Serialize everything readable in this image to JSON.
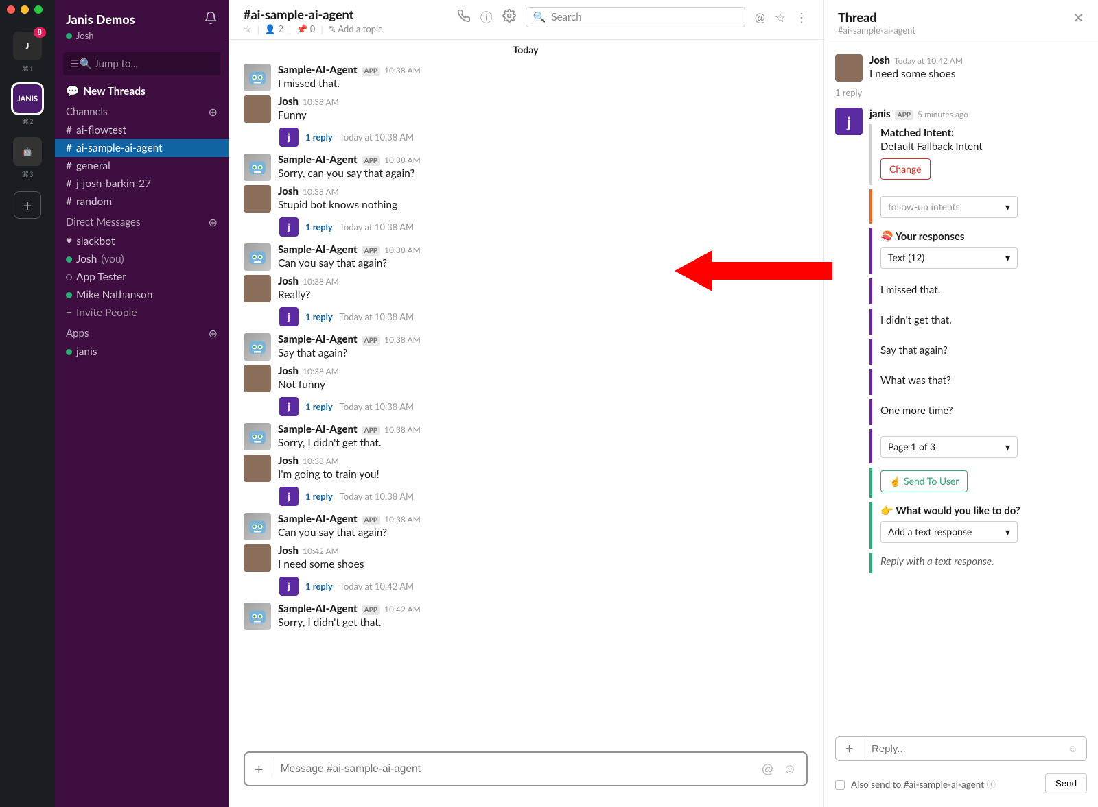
{
  "workspace": {
    "badge": "8",
    "keys": [
      "⌘1",
      "⌘2",
      "⌘3"
    ],
    "title": "Janis Demos",
    "user": "Josh",
    "jump_placeholder": "Jump to...",
    "new_threads": "New Threads",
    "channels_label": "Channels",
    "channels": [
      "ai-flowtest",
      "ai-sample-ai-agent",
      "general",
      "j-josh-barkin-27",
      "random"
    ],
    "active_channel_index": 1,
    "dm_label": "Direct Messages",
    "dms": [
      {
        "name": "slackbot",
        "presence": "heart"
      },
      {
        "name": "Josh",
        "suffix": "(you)",
        "presence": "active"
      },
      {
        "name": "App Tester",
        "presence": "away"
      },
      {
        "name": "Mike Nathanson",
        "presence": "active"
      }
    ],
    "invite": "Invite People",
    "apps_label": "Apps",
    "apps": [
      {
        "name": "janis",
        "presence": "active"
      }
    ]
  },
  "header": {
    "channel": "#ai-sample-ai-agent",
    "members": "2",
    "pins": "0",
    "add_topic": "Add a topic",
    "search_placeholder": "Search"
  },
  "divider": "Today",
  "messages": [
    {
      "sender": "Sample-AI-Agent",
      "app": true,
      "time": "10:38 AM",
      "text": "I missed that.",
      "avatar": "bot"
    },
    {
      "sender": "Josh",
      "time": "10:38 AM",
      "text": "Funny",
      "avatar": "josh",
      "reply": "1 reply",
      "reply_time": "Today at 10:38 AM"
    },
    {
      "sender": "Sample-AI-Agent",
      "app": true,
      "time": "10:38 AM",
      "text": "Sorry, can you say that again?",
      "avatar": "bot"
    },
    {
      "sender": "Josh",
      "time": "10:38 AM",
      "text": "Stupid bot knows nothing",
      "avatar": "josh",
      "reply": "1 reply",
      "reply_time": "Today at 10:38 AM"
    },
    {
      "sender": "Sample-AI-Agent",
      "app": true,
      "time": "10:38 AM",
      "text": "Can you say that again?",
      "avatar": "bot"
    },
    {
      "sender": "Josh",
      "time": "10:38 AM",
      "text": "Really?",
      "avatar": "josh",
      "reply": "1 reply",
      "reply_time": "Today at 10:38 AM"
    },
    {
      "sender": "Sample-AI-Agent",
      "app": true,
      "time": "10:38 AM",
      "text": "Say that again?",
      "avatar": "bot"
    },
    {
      "sender": "Josh",
      "time": "10:38 AM",
      "text": "Not funny",
      "avatar": "josh",
      "reply": "1 reply",
      "reply_time": "Today at 10:38 AM"
    },
    {
      "sender": "Sample-AI-Agent",
      "app": true,
      "time": "10:38 AM",
      "text": "Sorry, I didn't get that.",
      "avatar": "bot"
    },
    {
      "sender": "Josh",
      "time": "10:38 AM",
      "text": "I'm going to train you!",
      "avatar": "josh",
      "reply": "1 reply",
      "reply_time": "Today at 10:38 AM"
    },
    {
      "sender": "Sample-AI-Agent",
      "app": true,
      "time": "10:38 AM",
      "text": "Can you say that again?",
      "avatar": "bot"
    },
    {
      "sender": "Josh",
      "time": "10:42 AM",
      "text": "I need some shoes",
      "avatar": "josh",
      "reply": "1 reply",
      "reply_time": "Today at 10:42 AM"
    },
    {
      "sender": "Sample-AI-Agent",
      "app": true,
      "time": "10:42 AM",
      "text": "Sorry, I didn't get that.",
      "avatar": "bot"
    }
  ],
  "composer": {
    "placeholder": "Message #ai-sample-ai-agent"
  },
  "thread": {
    "title": "Thread",
    "subtitle": "#ai-sample-ai-agent",
    "root": {
      "sender": "Josh",
      "time": "Today at 10:42 AM",
      "text": "I need some shoes"
    },
    "reply_count": "1 reply",
    "janis": {
      "sender": "janis",
      "app": true,
      "time": "5 minutes ago"
    },
    "matched_title": "Matched Intent:",
    "matched_value": "Default Fallback Intent",
    "change_btn": "Change",
    "followup_placeholder": "follow-up intents",
    "responses_title": "🍣 Your responses",
    "responses_select": "Text (12)",
    "responses": [
      "I missed that.",
      "I didn't get that.",
      "Say that again?",
      "What was that?",
      "One more time?"
    ],
    "page_select": "Page 1 of 3",
    "send_user": "☝️ Send To User",
    "do_title": "👉 What would you like to do?",
    "do_select": "Add a text response",
    "do_hint": "Reply with a text response.",
    "reply_placeholder": "Reply...",
    "also_send": "Also send to #ai-sample-ai-agent",
    "send_btn": "Send"
  }
}
